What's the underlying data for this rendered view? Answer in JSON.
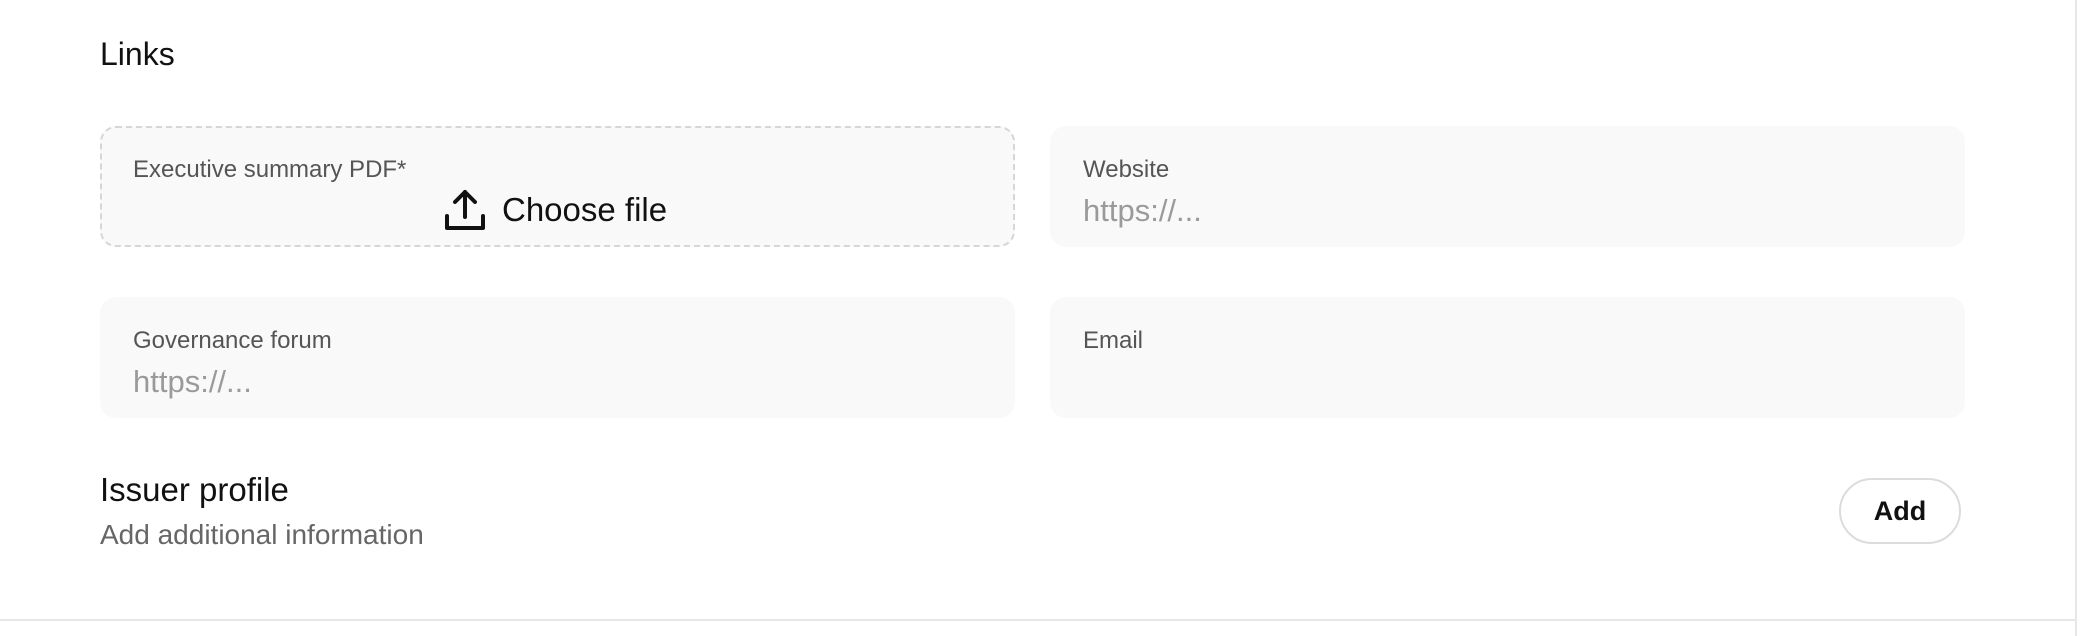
{
  "links": {
    "title": "Links",
    "executive_summary": {
      "label": "Executive summary PDF*",
      "button_label": "Choose file",
      "icon": "upload-icon"
    },
    "website": {
      "label": "Website",
      "placeholder": "https://...",
      "value": ""
    },
    "governance_forum": {
      "label": "Governance forum",
      "placeholder": "https://...",
      "value": ""
    },
    "email": {
      "label": "Email",
      "placeholder": "",
      "value": ""
    }
  },
  "issuer_profile": {
    "title": "Issuer profile",
    "subtitle": "Add additional information",
    "add_label": "Add"
  },
  "colors": {
    "field_background": "#f9f9f9",
    "dashed_border": "#d6d6d6",
    "label_text": "#555555",
    "placeholder_text": "#9a9a9a",
    "muted_text": "#666666"
  }
}
